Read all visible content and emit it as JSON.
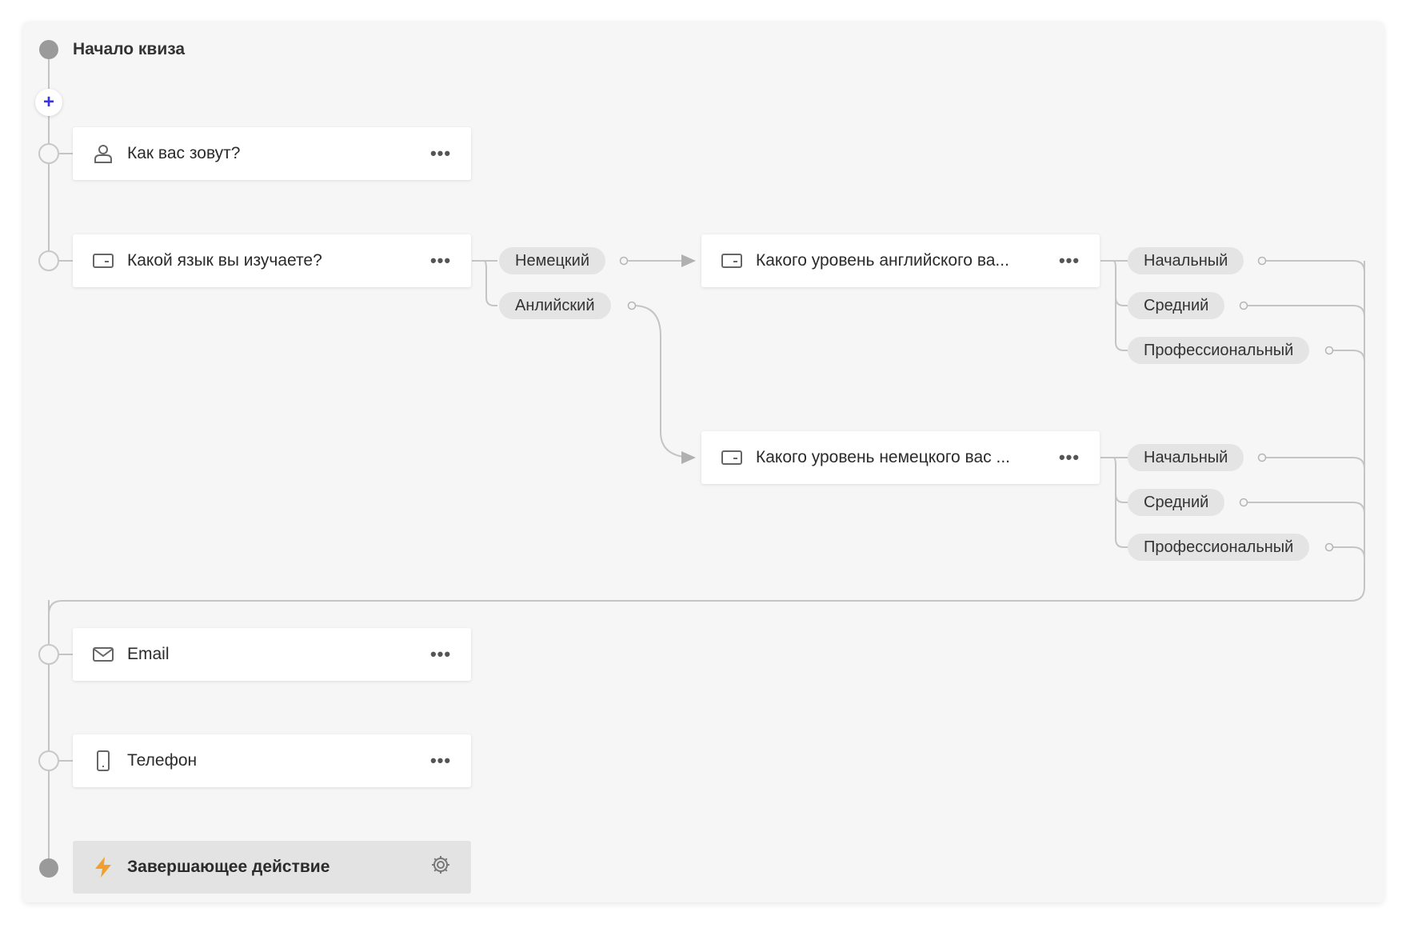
{
  "start": {
    "title": "Начало квиза"
  },
  "add_button": {
    "symbol": "+"
  },
  "questions": [
    {
      "label": "Как вас зовут?",
      "icon": "user-icon"
    },
    {
      "label": "Какой язык вы изучаете?",
      "icon": "select-icon"
    },
    {
      "label": "Email",
      "icon": "mail-icon"
    },
    {
      "label": "Телефон",
      "icon": "phone-icon"
    }
  ],
  "language_options": [
    "Немецкий",
    "Анлийский"
  ],
  "branch_questions": [
    {
      "label": "Какого уровень английского ва...",
      "icon": "select-icon"
    },
    {
      "label": "Какого уровень немецкого вас ...",
      "icon": "select-icon"
    }
  ],
  "level_options": [
    "Начальный",
    "Средний",
    "Профессиональный"
  ],
  "final_action": {
    "label": "Завершающее действие",
    "icon": "lightning-icon",
    "settings_icon": "gear-icon"
  },
  "more_label": "•••",
  "colors": {
    "accent": "#3b32e0",
    "lightning": "#f0a030",
    "line": "#bdbdbd"
  }
}
